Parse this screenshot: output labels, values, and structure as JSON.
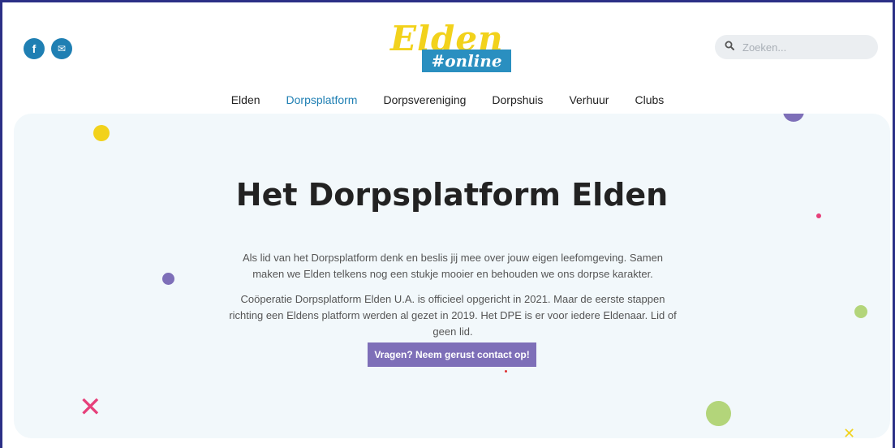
{
  "social": {
    "facebook_icon": "f",
    "mail_icon": "✉"
  },
  "logo": {
    "word": "Elden",
    "tag": "#online"
  },
  "search": {
    "placeholder": "Zoeken..."
  },
  "nav": {
    "items": [
      "Elden",
      "Dorpsplatform",
      "Dorpsvereniging",
      "Dorpshuis",
      "Verhuur",
      "Clubs"
    ],
    "active": "Dorpsplatform"
  },
  "hero": {
    "title": "Het Dorpsplatform Elden",
    "paragraph1": "Als lid van het Dorpsplatform denk en beslis jij mee over jouw eigen leefomgeving. Samen maken we Elden telkens nog een stukje mooier en behouden we ons dorpse karakter.",
    "paragraph2": "Coöperatie Dorpsplatform Elden U.A. is officieel opgericht in 2021. Maar de eerste stappen richting een Eldens platform werden al gezet in 2019. Het DPE is er voor iedere Eldenaar. Lid of geen lid.",
    "cta_label": "Vragen? Neem gerust contact op!"
  },
  "colors": {
    "accent": "#1f7fb3",
    "button": "#7e6fb8",
    "logo_yellow": "#f2d21c",
    "hero_bg": "#f2f8fb"
  }
}
